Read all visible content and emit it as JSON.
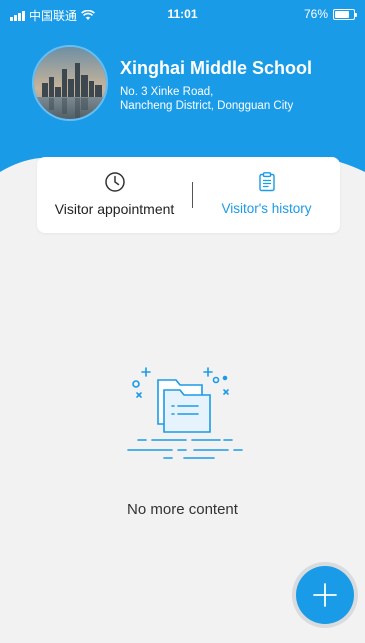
{
  "status_bar": {
    "carrier": "中国联通",
    "time": "11:01",
    "battery_text": "76%",
    "battery_level": 0.76
  },
  "school": {
    "name": "Xinghai Middle School",
    "address_line1": "No. 3 Xinke Road,",
    "address_line2": "Nancheng District, Dongguan City",
    "avatar_icon": "city-skyline-photo"
  },
  "tabs": [
    {
      "label": "Visitor appointment",
      "icon": "clock-icon",
      "active": false
    },
    {
      "label": "Visitor's history",
      "icon": "clipboard-icon",
      "active": true
    }
  ],
  "empty_state": {
    "icon": "empty-folder-illustration",
    "text": "No more content"
  },
  "fab": {
    "icon": "plus-icon"
  },
  "colors": {
    "primary": "#1a9be8",
    "background": "#f2f2f3",
    "text_dark": "#222222"
  }
}
